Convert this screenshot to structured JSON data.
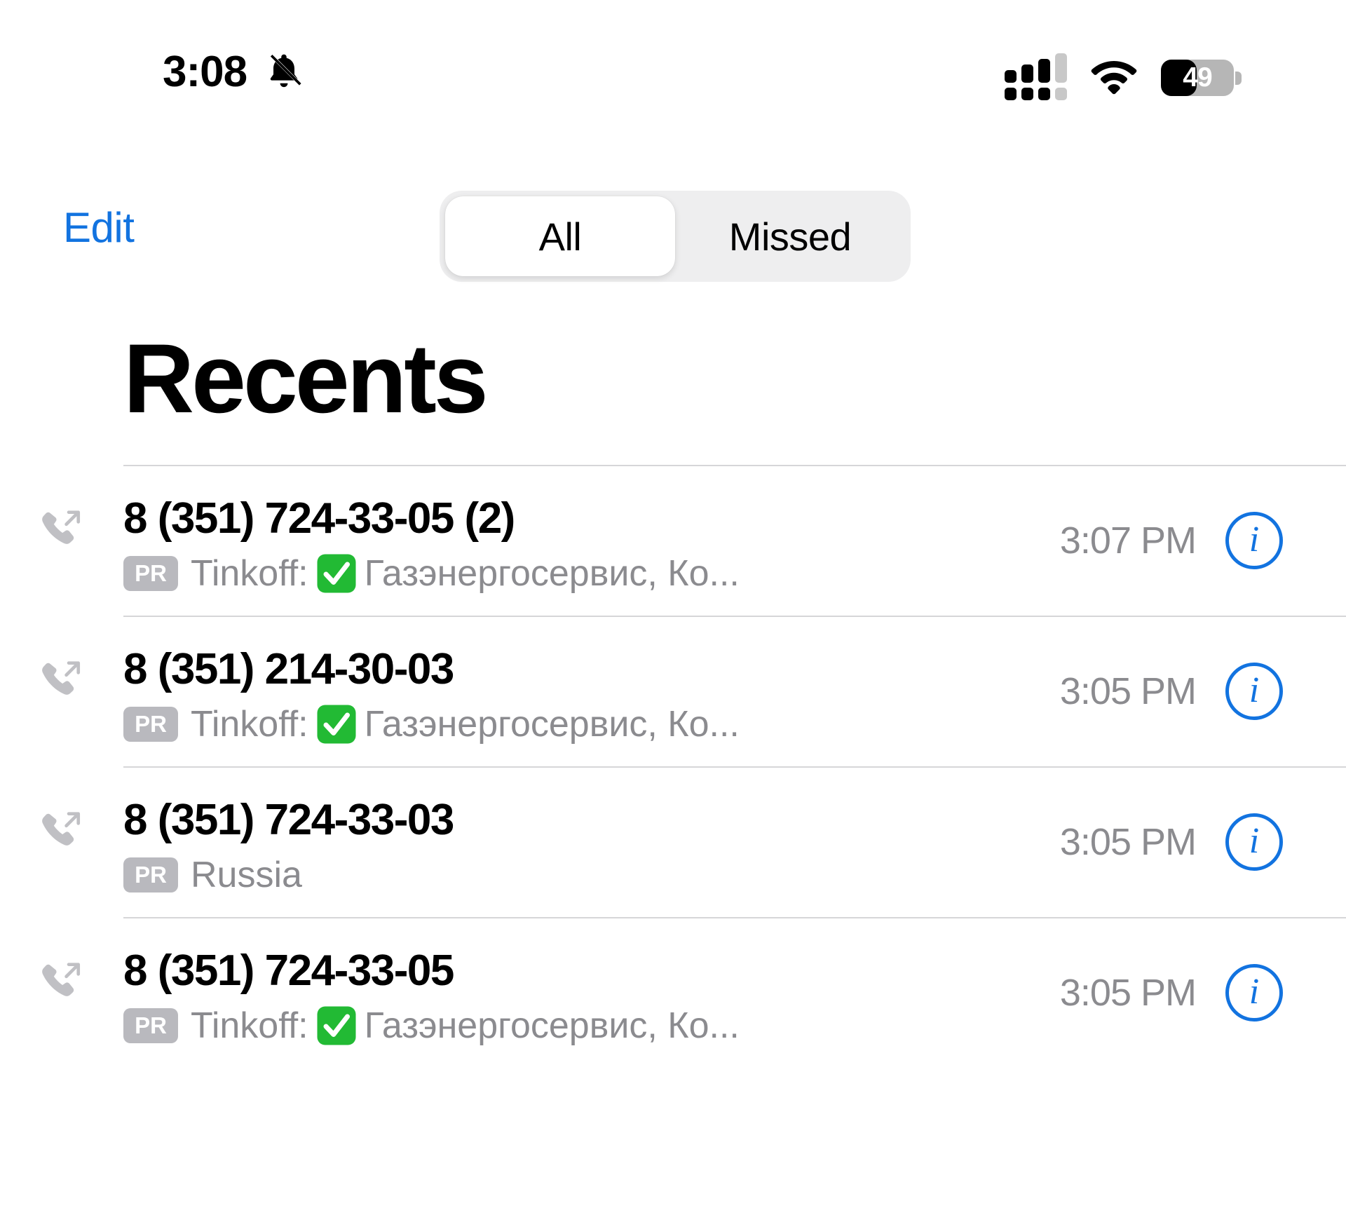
{
  "status_bar": {
    "time": "3:08",
    "silent_icon": "bell-slash-icon",
    "signal_icon": "dual-sim-signal-icon",
    "signal_bars_filled": 3,
    "signal_bars_total": 4,
    "wifi_icon": "wifi-icon",
    "battery_percent": "49",
    "battery_level": 49
  },
  "nav": {
    "edit_label": "Edit",
    "segments": [
      {
        "label": "All",
        "selected": true
      },
      {
        "label": "Missed",
        "selected": false
      }
    ]
  },
  "page": {
    "title": "Recents"
  },
  "colors": {
    "accent_blue": "#1273e0",
    "secondary_text": "#8b8b8f",
    "badge_gray": "#b9b9be",
    "segment_track": "#eeeeef",
    "divider": "#d6d6d8",
    "check_green": "#22ba34"
  },
  "calls": [
    {
      "type_icon": "outgoing-call-icon",
      "number": "8 (351) 724-33-05 (2)",
      "badge": "PR",
      "label_before": "Tinkoff:",
      "has_check": true,
      "label_after": "Газэнергосервис, Ко...",
      "time": "3:07 PM",
      "info_icon": "info-circle-icon"
    },
    {
      "type_icon": "outgoing-call-icon",
      "number": "8 (351) 214-30-03",
      "badge": "PR",
      "label_before": "Tinkoff:",
      "has_check": true,
      "label_after": "Газэнергосервис, Ко...",
      "time": "3:05 PM",
      "info_icon": "info-circle-icon"
    },
    {
      "type_icon": "outgoing-call-icon",
      "number": "8 (351) 724-33-03",
      "badge": "PR",
      "label_before": "Russia",
      "has_check": false,
      "label_after": "",
      "time": "3:05 PM",
      "info_icon": "info-circle-icon"
    },
    {
      "type_icon": "outgoing-call-icon",
      "number": "8 (351) 724-33-05",
      "badge": "PR",
      "label_before": "Tinkoff:",
      "has_check": true,
      "label_after": "Газэнергосервис, Ко...",
      "time": "3:05 PM",
      "info_icon": "info-circle-icon"
    }
  ]
}
